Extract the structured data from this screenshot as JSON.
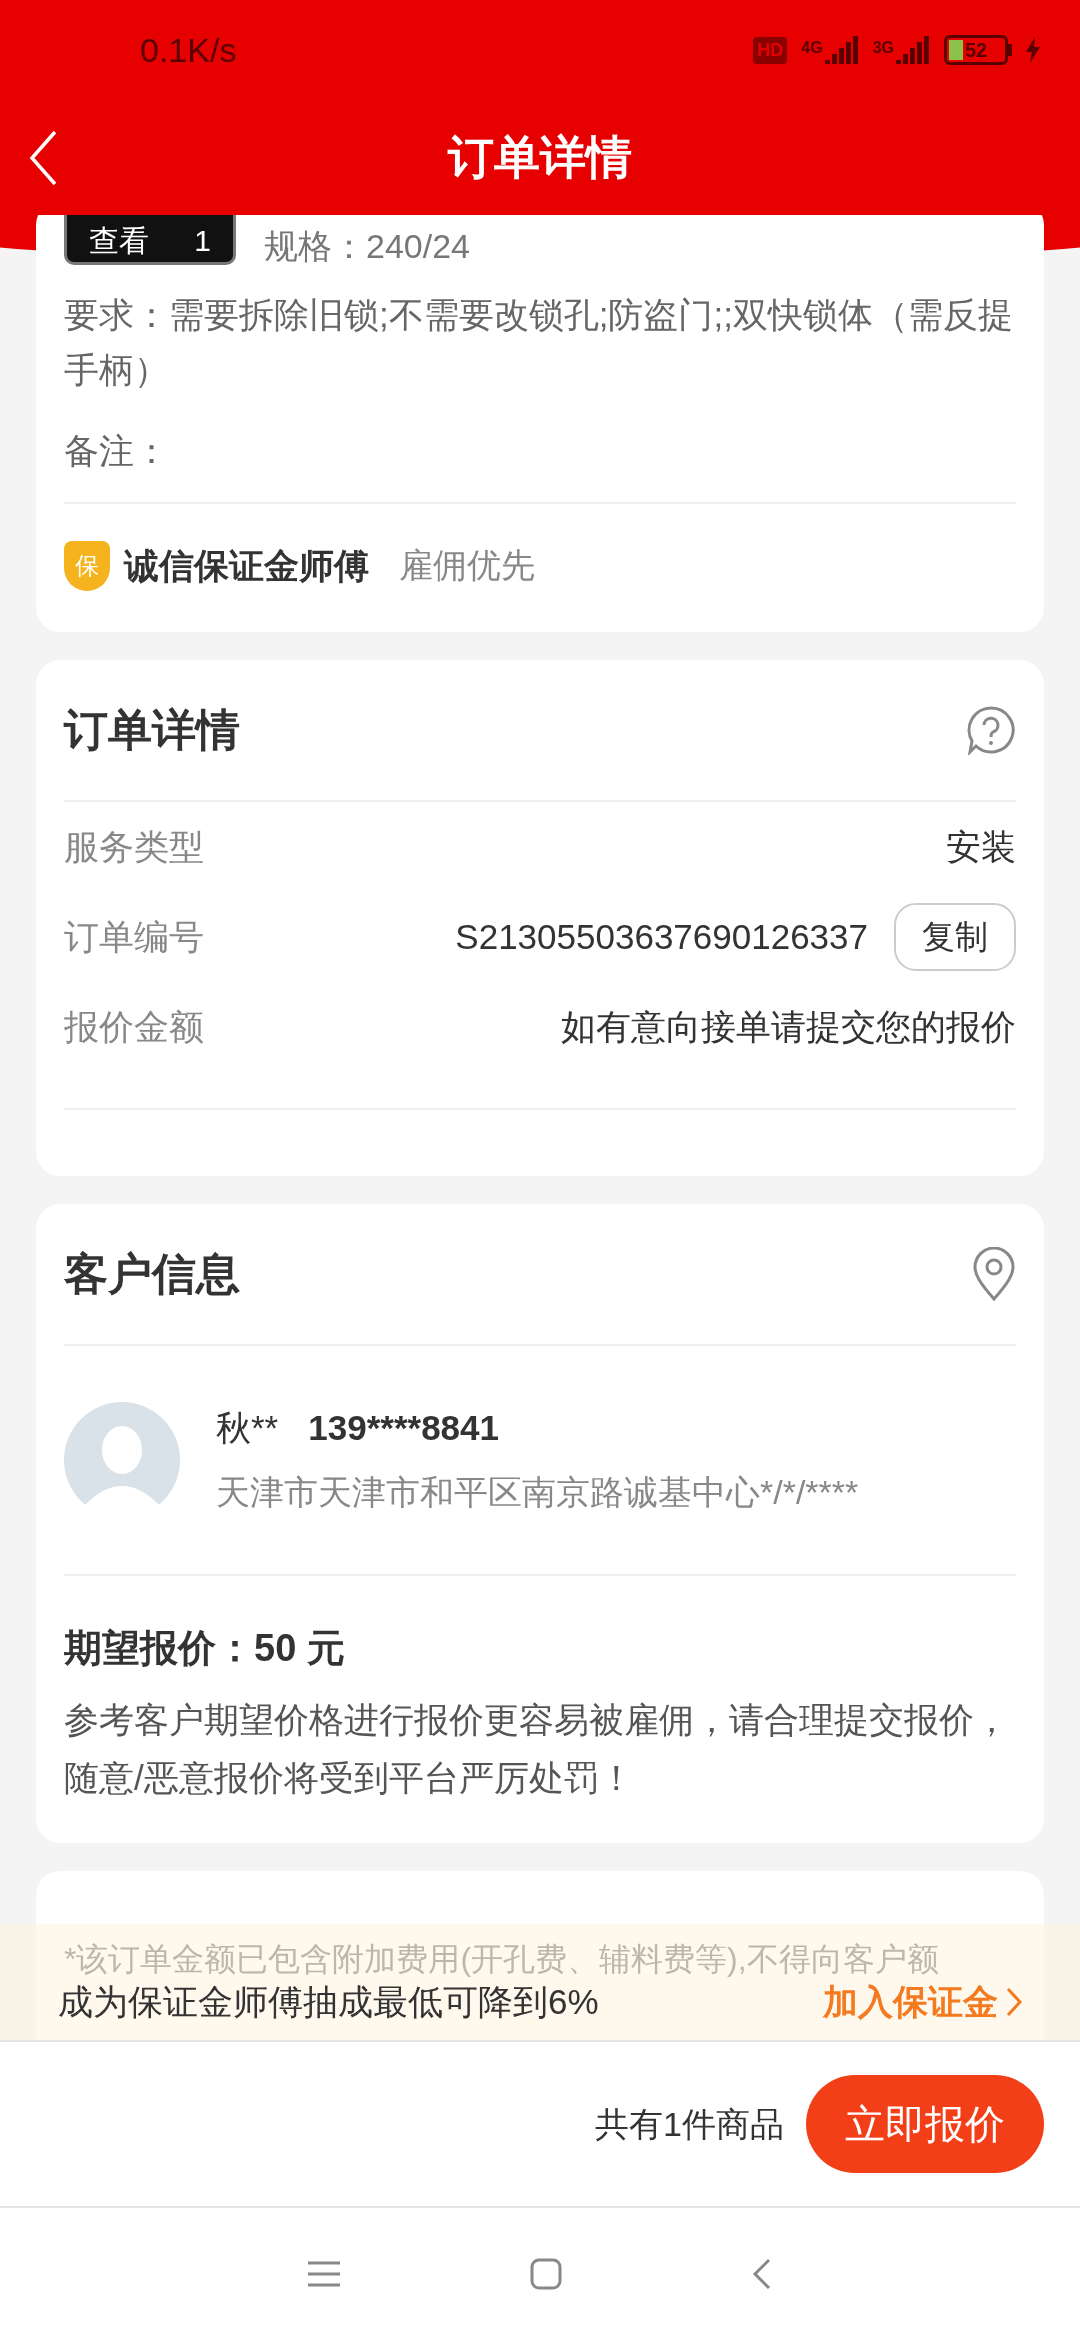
{
  "status_bar": {
    "network_speed": "0.1K/s",
    "hd": "HD",
    "signals": [
      "4G",
      "3G"
    ],
    "battery": "52"
  },
  "header": {
    "title": "订单详情"
  },
  "product": {
    "thumbnail_label": "查看",
    "thumbnail_count": "1",
    "spec": "规格：240/24",
    "requirements": "要求：需要拆除旧锁;不需要改锁孔;防盗门;;双快锁体（需反提手柄）",
    "remark": "备注：",
    "guarantee_badge": "保",
    "guarantee_title": "诚信保证金师傅",
    "guarantee_note": "雇佣优先"
  },
  "order_details": {
    "title": "订单详情",
    "rows": [
      {
        "label": "服务类型",
        "value": "安装"
      },
      {
        "label": "订单编号",
        "value": "S21305503637690126337",
        "action": "复制"
      },
      {
        "label": "报价金额",
        "value": "如有意向接单请提交您的报价"
      }
    ]
  },
  "customer": {
    "title": "客户信息",
    "name": "秋**",
    "phone": "139****8841",
    "address": "天津市天津市和平区南京路诚基中心*/*/****",
    "expected_price": "期望报价：50 元",
    "notice": "参考客户期望价格进行报价更容易被雇佣，请合理提交报价，随意/恶意报价将受到平台严厉处罚！"
  },
  "fee_note": "*该订单金额已包含附加费用(开孔费、辅料费等),不得向客户额",
  "banner": {
    "text": "成为保证金师傅抽成最低可降到6%",
    "link": "加入保证金"
  },
  "footer": {
    "item_count": "共有1件商品",
    "button": "立即报价"
  }
}
